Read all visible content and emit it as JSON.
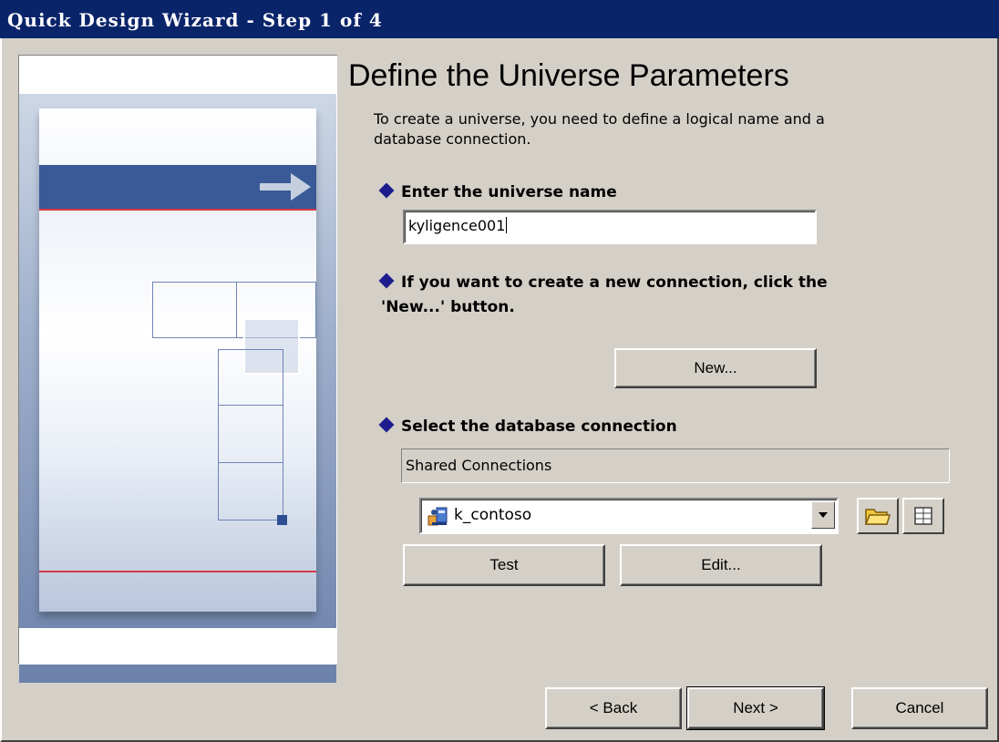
{
  "window": {
    "title": "Quick Design Wizard - Step 1 of 4"
  },
  "page": {
    "heading": "Define the Universe Parameters",
    "intro": "To create a universe, you need to define a logical name and a database connection."
  },
  "steps": {
    "name_label": "Enter the universe name",
    "new_conn_label": "If you want to create a new connection, click the 'New...' button.",
    "select_label": "Select the database connection"
  },
  "universe_name": {
    "value": "kyligence001"
  },
  "new_button": {
    "label": "New..."
  },
  "shared_connections": {
    "label": "Shared Connections"
  },
  "connection": {
    "selected": "k_contoso"
  },
  "buttons": {
    "test": "Test",
    "edit": "Edit...",
    "back": "< Back",
    "next": "Next >",
    "cancel": "Cancel"
  },
  "colors": {
    "titlebar": "#0a246a",
    "diamond": "#1c1c8c",
    "accent_band": "#3a5a97"
  }
}
